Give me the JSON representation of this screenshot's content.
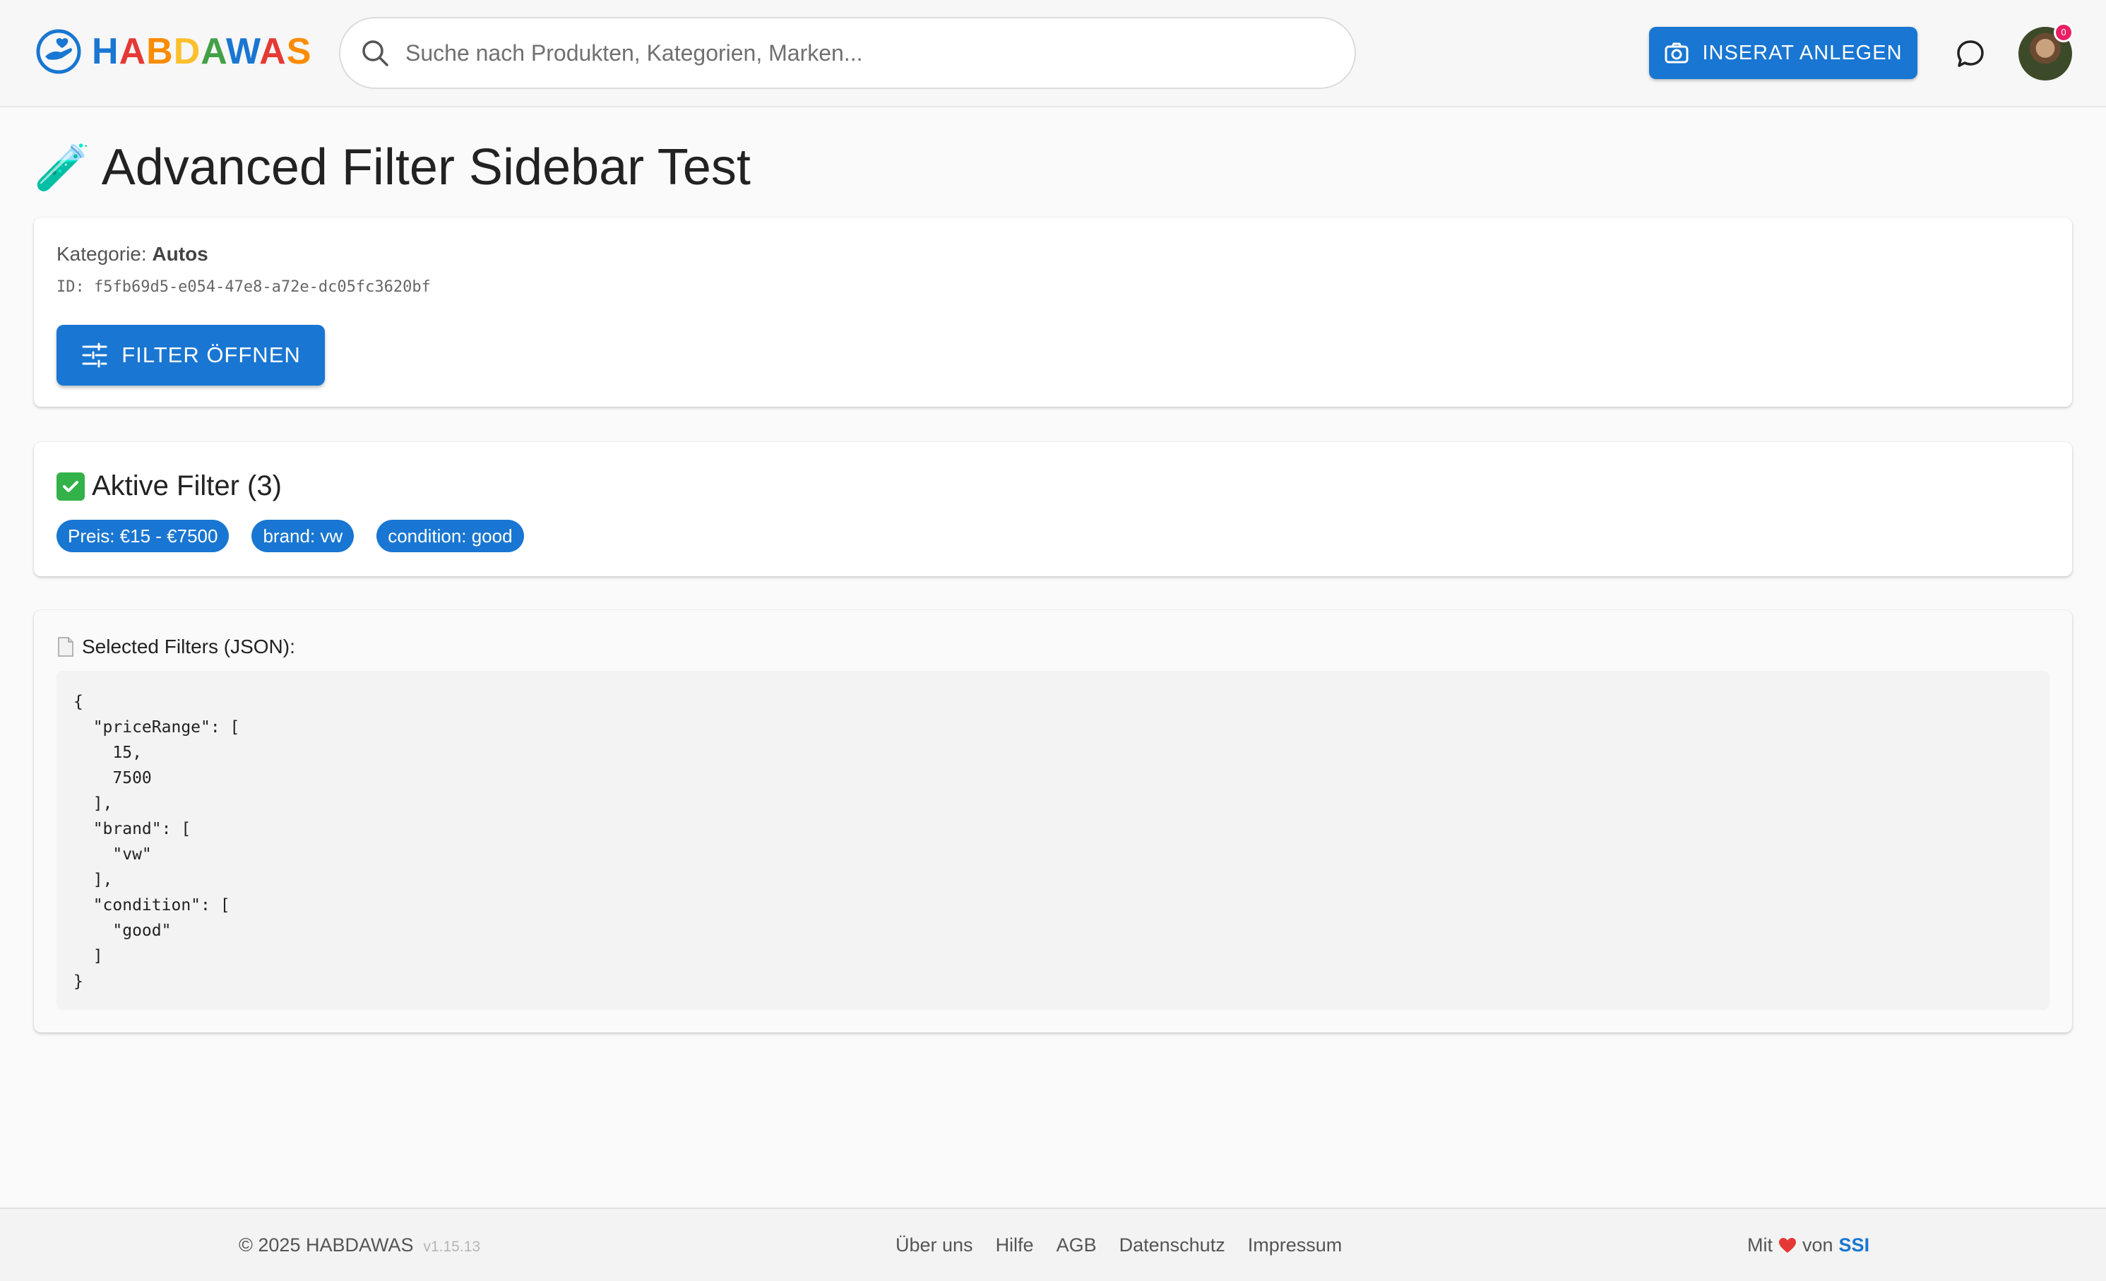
{
  "header": {
    "logo_text": "HABDAWAS",
    "search_placeholder": "Suche nach Produkten, Kategorien, Marken...",
    "create_listing_label": "INSERAT ANLEGEN",
    "avatar_badge": "0"
  },
  "page": {
    "title_emoji": "🧪",
    "title": "Advanced Filter Sidebar Test"
  },
  "category_card": {
    "kategorie_prefix": "Kategorie: ",
    "kategorie_value": "Autos",
    "id_line": "ID: f5fb69d5-e054-47e8-a72e-dc05fc3620bf",
    "filter_button_label": "FILTER ÖFFNEN"
  },
  "active_filters": {
    "title": "Aktive Filter (3)",
    "chips": [
      "Preis: €15 - €7500",
      "brand: vw",
      "condition: good"
    ]
  },
  "json_card": {
    "title": "Selected Filters (JSON):",
    "json_text": "{\n  \"priceRange\": [\n    15,\n    7500\n  ],\n  \"brand\": [\n    \"vw\"\n  ],\n  \"condition\": [\n    \"good\"\n  ]\n}"
  },
  "footer": {
    "copyright": "© 2025 HABDAWAS",
    "version": "v1.15.13",
    "links": [
      "Über uns",
      "Hilfe",
      "AGB",
      "Datenschutz",
      "Impressum"
    ],
    "made_with_prefix": "Mit",
    "made_with_von": "von",
    "made_with_brand": "SSI"
  },
  "colors": {
    "primary": "#1976d2",
    "logo_letters": [
      "#1976d2",
      "#e53935",
      "#fb8c00",
      "#fbc02d",
      "#43a047",
      "#1976d2",
      "#e53935",
      "#fb8c00"
    ],
    "check_green": "#33b249",
    "heart_red": "#e53935",
    "badge_pink": "#e91e63"
  },
  "icons": {
    "logo": "hand-heart-icon",
    "search": "search-icon",
    "camera": "camera-icon",
    "chat": "chat-bubble-icon",
    "filter": "tune-sliders-icon",
    "check": "check-box-icon",
    "document": "document-icon",
    "heart": "heart-icon"
  }
}
